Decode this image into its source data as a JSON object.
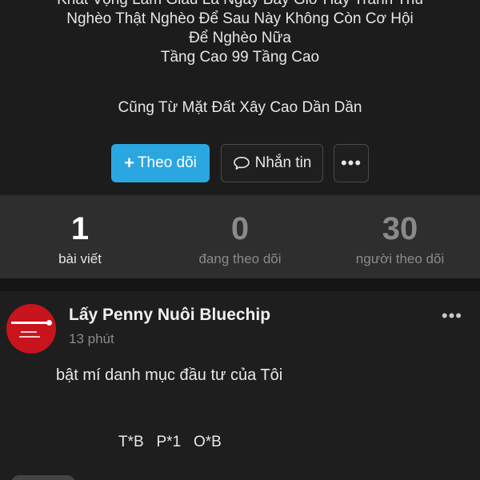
{
  "bio": {
    "lines": [
      "Khát Vọng Làm Giàu Là Ngày Bây Giờ Hãy Tranh Thủ",
      "Nghèo Thật Nghèo Để Sau Này Không Còn Cơ Hội",
      "Để Nghèo Nữa",
      "Tầng Cao 99 Tầng Cao"
    ],
    "motto": "Cũng Từ Mặt Đất Xây Cao Dần Dần"
  },
  "actions": {
    "follow_label": "Theo dõi",
    "message_label": "Nhắn tin",
    "more_label": "•••"
  },
  "stats": [
    {
      "value": "1",
      "label": "bài viết"
    },
    {
      "value": "0",
      "label": "đang theo dõi"
    },
    {
      "value": "30",
      "label": "người theo dõi"
    }
  ],
  "post": {
    "author": "Lấy Penny Nuôi Bluechip",
    "time": "13 phút",
    "more_label": "•••",
    "text": "bật mí danh mục đầu tư của Tôi",
    "tickers": "T*B   P*1   O*B"
  },
  "colors": {
    "accent": "#2aa7e0",
    "background": "#1c1c1c",
    "stats_background": "#2e2e2e",
    "avatar": "#c8141c"
  },
  "icons": {
    "follow": "plus-icon",
    "message": "chat-bubble-icon",
    "more": "more-dots-icon"
  }
}
